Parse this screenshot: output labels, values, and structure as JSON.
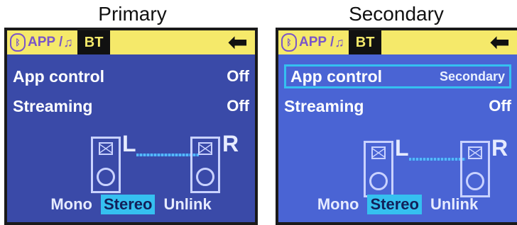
{
  "captions": {
    "left": "Primary",
    "right": "Secondary"
  },
  "panels": {
    "left": {
      "tab_app": "APP /",
      "tab_bt": "BT",
      "rows": [
        {
          "label": "App control",
          "value": "Off"
        },
        {
          "label": "Streaming",
          "value": "Off"
        }
      ],
      "speakers": {
        "left_label": "L",
        "right_label": "R"
      },
      "modes": [
        "Mono",
        "Stereo",
        "Unlink"
      ],
      "selected_mode": "Stereo"
    },
    "right": {
      "tab_app": "APP /",
      "tab_bt": "BT",
      "rows": [
        {
          "label": "App control",
          "value": "Secondary"
        },
        {
          "label": "Streaming",
          "value": "Off"
        }
      ],
      "speakers": {
        "left_label": "L",
        "right_label": "R"
      },
      "modes": [
        "Mono",
        "Stereo",
        "Unlink"
      ],
      "selected_mode": "Stereo"
    }
  },
  "icons": {
    "bluetooth": "bluetooth-icon",
    "music": "music-note-icon",
    "back": "back-arrow-icon"
  },
  "colors": {
    "topbar": "#f5e96a",
    "primary_screen": "#3a4aa8",
    "secondary_screen": "#4a64d4",
    "selection": "#35c0f0",
    "text": "#ffffff"
  }
}
